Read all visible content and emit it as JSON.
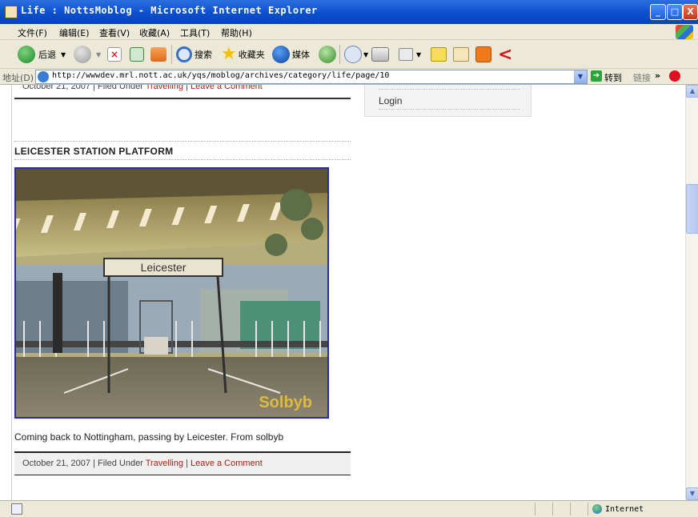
{
  "window": {
    "title": "Life : NottsMoblog - Microsoft Internet Explorer",
    "minimize": "_",
    "maximize": "□",
    "close": "X"
  },
  "menu": [
    "文件(F)",
    "编辑(E)",
    "查看(V)",
    "收藏(A)",
    "工具(T)",
    "帮助(H)"
  ],
  "toolbar": {
    "back_label": "后退",
    "search_label": "搜索",
    "favorites_label": "收藏夹",
    "media_label": "媒体"
  },
  "address": {
    "label": "地址(D)",
    "url": "http://wwwdev.mrl.nott.ac.uk/yqs/moblog/archives/category/life/page/10",
    "go_label": "转到",
    "links_label": "链接",
    "more": "»"
  },
  "page": {
    "top_meta": {
      "date": "October 21, 2007",
      "sep1": " | Filed Under ",
      "category": "Travelling",
      "sep2": " | ",
      "comment": "Leave a Comment"
    },
    "sidebar": {
      "login": "Login"
    },
    "post": {
      "title": "LEICESTER STATION PLATFORM",
      "image_sign": "Leicester",
      "watermark": "Solbyb",
      "caption": "Coming back to Nottingham, passing by Leicester. From solbyb",
      "meta": {
        "date": "October 21, 2007",
        "sep1": " | Filed Under ",
        "category": "Travelling",
        "sep2": " | ",
        "comment": "Leave a Comment"
      }
    }
  },
  "status": {
    "zone": "Internet"
  }
}
